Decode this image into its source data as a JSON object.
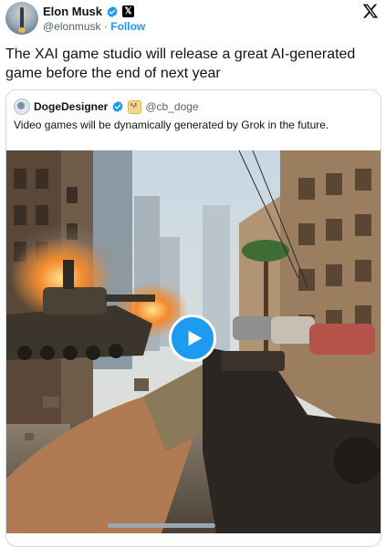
{
  "author": {
    "name": "Elon Musk",
    "handle": "@elonmusk",
    "separator": "·",
    "follow_label": "Follow",
    "verified_color": "#1d9bf0"
  },
  "tweet": {
    "text": "The XAI game studio will release a great AI-generated game before the end of next year"
  },
  "quoted": {
    "name": "DogeDesigner",
    "handle": "@cb_doge",
    "text": "Video games will be dynamically generated by Grok in the future."
  },
  "media": {
    "type": "video",
    "play_icon": "play-icon",
    "accent": "#1d9bf0"
  },
  "icons": {
    "x_logo": "x-logo-icon",
    "verified": "verified-badge-icon",
    "x_affiliate": "x-affiliate-badge-icon"
  }
}
